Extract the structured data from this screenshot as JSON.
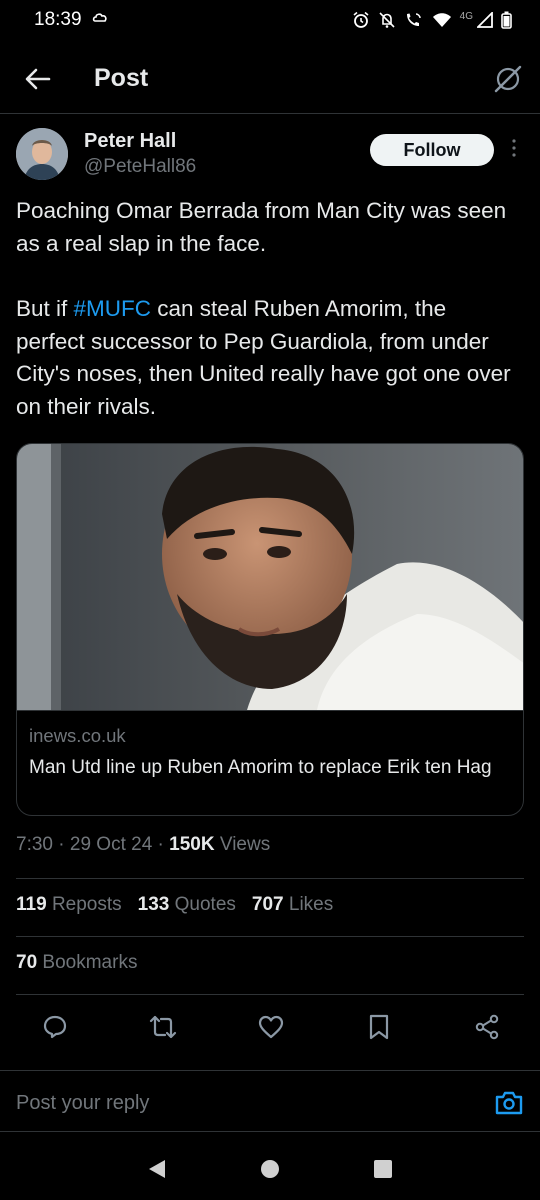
{
  "status_bar": {
    "time": "18:39",
    "network": "4G"
  },
  "header": {
    "title": "Post"
  },
  "author": {
    "name": "Peter Hall",
    "handle": "@PeteHall86",
    "follow_label": "Follow"
  },
  "tweet": {
    "paragraph1": "Poaching Omar Berrada from Man City was seen as a real slap in the face.",
    "p2_before": "But if ",
    "hashtag": "#MUFC",
    "p2_after": " can steal Ruben Amorim, the perfect successor to Pep Guardiola, from under City's noses, then United really have got one over on their rivals."
  },
  "card": {
    "domain": "inews.co.uk",
    "title": "Man Utd line up Ruben Amorim to replace Erik ten Hag"
  },
  "meta": {
    "time": "7:30",
    "date": "29 Oct 24",
    "views_count": "150K",
    "views_label": "Views"
  },
  "stats": {
    "reposts_count": "119",
    "reposts_label": "Reposts",
    "quotes_count": "133",
    "quotes_label": "Quotes",
    "likes_count": "707",
    "likes_label": "Likes",
    "bookmarks_count": "70",
    "bookmarks_label": "Bookmarks"
  },
  "reply": {
    "placeholder": "Post your reply"
  },
  "colors": {
    "background": "#000000",
    "accent": "#1d9bf0",
    "secondary_text": "#71767b",
    "divider": "#2f3336"
  },
  "icons": [
    "back-arrow-icon",
    "grok-icon",
    "more-icon",
    "reply-icon",
    "repost-icon",
    "like-icon",
    "bookmark-icon",
    "share-icon",
    "camera-icon"
  ]
}
